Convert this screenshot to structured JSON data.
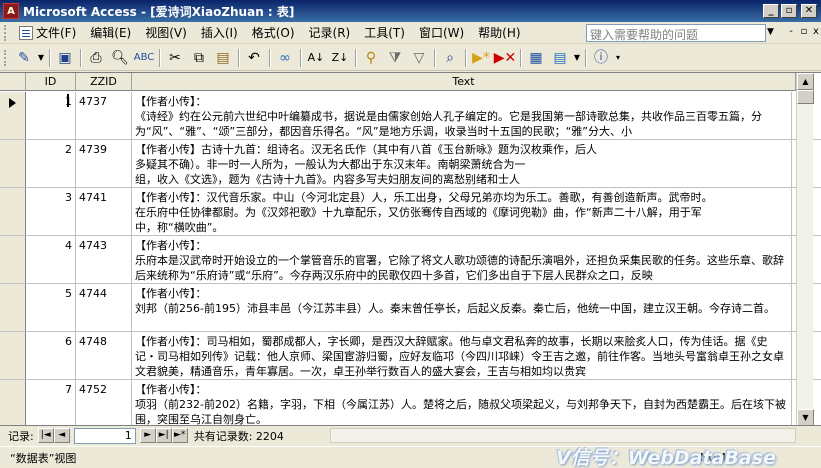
{
  "window": {
    "app_icon": "A",
    "title": "Microsoft Access - [爱诗词XiaoZhuan : 表]",
    "minimize": "_",
    "restore": "▫",
    "close": "✕"
  },
  "menu": {
    "items": [
      "文件(F)",
      "编辑(E)",
      "视图(V)",
      "插入(I)",
      "格式(O)",
      "记录(R)",
      "工具(T)",
      "窗口(W)",
      "帮助(H)"
    ],
    "help_placeholder": "键入需要帮助的问题",
    "doc_minimize": "-",
    "doc_restore": "▫",
    "doc_close": "x"
  },
  "toolbar": {
    "icons": [
      "view-design-icon",
      "save-icon",
      "print-icon",
      "print-preview-icon",
      "spell-check-icon",
      "cut-icon",
      "copy-icon",
      "paste-icon",
      "undo-icon",
      "hyperlink-icon",
      "sort-asc-icon",
      "sort-desc-icon",
      "filter-selection-icon",
      "filter-form-icon",
      "apply-filter-icon",
      "find-icon",
      "new-record-icon",
      "delete-record-icon",
      "database-window-icon",
      "new-object-icon",
      "help-icon"
    ]
  },
  "table": {
    "columns": [
      "ID",
      "ZZID",
      "Text"
    ],
    "rows": [
      {
        "id": "1",
        "zzid": "4737",
        "text": "【作者小传】：\n《诗经》约在公元前六世纪中叶编纂成书，据说是由儒家创始人孔子编定的。它是我国第一部诗歌总集，共收作品三百零五篇，分为“风”、“雅”、“颂”三部分，都因音乐得名。“风”是地方乐调，收录当时十五国的民歌；“雅”分大、小"
      },
      {
        "id": "2",
        "zzid": "4739",
        "text": "【作者小传】古诗十九首：组诗名。汉无名氏作（其中有八首《玉台新咏》题为汉枚乘作，后人\n多疑其不确）。非一时一人所为，一般认为大都出于东汉末年。南朝梁萧统合为一\n组，收入《文选》，题为《古诗十九首》。内容多写夫妇朋友间的离愁别绪和士人"
      },
      {
        "id": "3",
        "zzid": "4741",
        "text": "【作者小传】：汉代音乐家。中山（今河北定县）人，乐工出身，父母兄弟亦均为乐工。善歌，有善创造新声。武帝时。\n在乐府中任协律都尉。为《汉郊祀歌》十九章配乐，又仿张骞传自西域的《摩诃兜勒》曲，作“新声二十八解，用于军\n中，称“横吹曲”。"
      },
      {
        "id": "4",
        "zzid": "4743",
        "text": "【作者小传】：\n乐府本是汉武帝时开始设立的一个掌管音乐的官署，它除了将文人歌功颂德的诗配乐演唱外，还担负采集民歌的任务。这些乐章、歌辞后来统称为“乐府诗”或“乐府”。今存两汉乐府中的民歌仅四十多首，它们多出自于下层人民群众之口，反映"
      },
      {
        "id": "5",
        "zzid": "4744",
        "text": "【作者小传】：\n刘邦（前256-前195）沛县丰邑（今江苏丰县）人。秦末曾任亭长，后起义反秦。秦亡后，他统一中国，建立汉王朝。今存诗二首。"
      },
      {
        "id": "6",
        "zzid": "4748",
        "text": "【作者小传】：司马相如，蜀郡成都人，字长卿，是西汉大辞赋家。他与卓文君私奔的故事，长期以来脍炙人口，传为佳话。据《史记・司马相如列传》记载：他人京师、梁国宦游归蜀，应好友临邛（今四川邛崃）令王吉之邀，前往作客。当地头号富翁卓王孙之女卓文君貌美，精通音乐，青年寡居。一次，卓王孙举行数百人的盛大宴会，王吉与相如均以贵宾"
      },
      {
        "id": "7",
        "zzid": "4752",
        "text": "【作者小传】：\n项羽（前232-前202）名籍，字羽，下相（今属江苏）人。楚将之后，随叔父项梁起义，与刘邦争天下，自封为西楚霸王。后在垓下被围，突围至乌江自刎身亡。"
      }
    ]
  },
  "navigation": {
    "label": "记录:",
    "current": "1",
    "total_label": "共有记录数: 2204",
    "first": "|◄",
    "prev": "◄",
    "next": "►",
    "last": "►|",
    "new": "►*"
  },
  "status": {
    "text": "“数据表”视图",
    "indicator": "NUM",
    "watermark": "V信号：WebDataBase"
  }
}
